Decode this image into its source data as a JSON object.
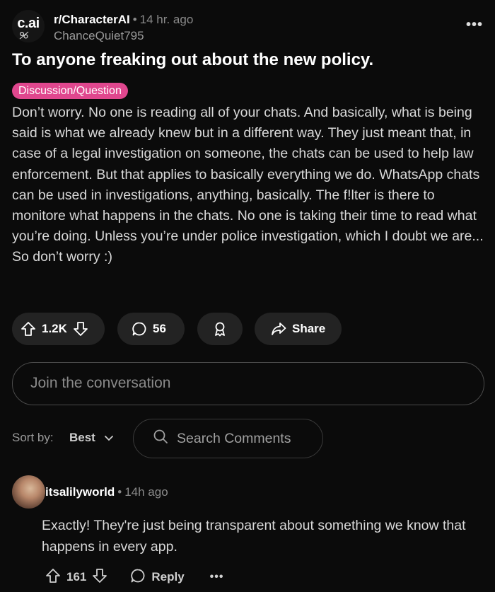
{
  "post": {
    "subreddit": "r/CharacterAI",
    "subreddit_logo_text": "c.ai",
    "time": "14 hr. ago",
    "author": "ChanceQuiet795",
    "more_label": "•••",
    "title": "To anyone freaking out about the new policy.",
    "flair": "Discussion/Question",
    "flair_color": "#e0478e",
    "body": "Don’t worry. No one is reading all of your chats. And basically, what is being said is what we already knew but in a different way. They just meant that, in case of a legal investigation on someone, the chats can be used to help law enforcement. But that applies to basically everything we do. WhatsApp chats can be used in investigations, anything, basically. The f!lter is there to monitore what happens in the chats. No one is taking their time to read what you’re doing. Unless you’re under police investigation, which I doubt we are... So don’t worry :)"
  },
  "actions": {
    "upvotes": "1.2K",
    "comments": "56",
    "share_label": "Share"
  },
  "join": {
    "placeholder": "Join the conversation"
  },
  "sort": {
    "label": "Sort by:",
    "value": "Best",
    "search_placeholder": "Search Comments"
  },
  "comment": {
    "username": "itsalilyworld",
    "time": "14h ago",
    "text": "Exactly! They're just being transparent about something we know that happens in every app.",
    "votes": "161",
    "reply_label": "Reply",
    "more_label": "•••"
  }
}
